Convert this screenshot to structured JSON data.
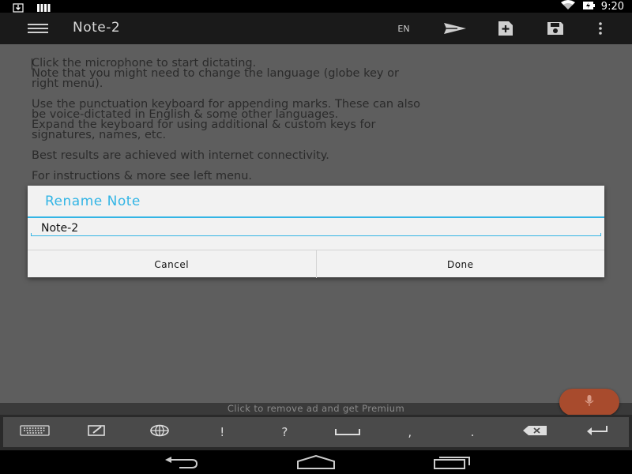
{
  "status_bar": {
    "time": "9:20",
    "icons": [
      "download-icon",
      "signal-bars-icon",
      "wifi-icon",
      "battery-charging-icon"
    ]
  },
  "action_bar": {
    "title": "Note-2",
    "language": "EN",
    "icons": [
      "menu-icon",
      "send-icon",
      "new-note-icon",
      "save-icon",
      "overflow-icon"
    ]
  },
  "note": {
    "paragraphs": [
      "Click the microphone to start dictating.\nNote that you might need to change the language (globe key or\nright menu).",
      "Use the punctuation keyboard for appending marks. These can also\nbe voice-dictated in English & some other languages.\nExpand the keyboard for using additional & custom keys for\nsignatures, names, etc.",
      "Best results are achieved with internet connectivity.",
      "For instructions & more see left menu."
    ]
  },
  "dialog": {
    "title": "Rename Note",
    "input_value": "Note-2",
    "cancel_label": "Cancel",
    "done_label": "Done"
  },
  "ad_banner": {
    "text": "Click to remove ad and get Premium"
  },
  "mic_button": {
    "icon": "microphone-icon",
    "color": "#a84b2d"
  },
  "keyboard_row": {
    "keys": [
      {
        "name": "keyboard-key",
        "icon": "keyboard-icon"
      },
      {
        "name": "edit-key",
        "icon": "edit-window-icon"
      },
      {
        "name": "globe-key",
        "icon": "globe-icon"
      },
      {
        "name": "exclamation-key",
        "label": "!"
      },
      {
        "name": "question-key",
        "label": "?"
      },
      {
        "name": "space-key",
        "icon": "space-icon"
      },
      {
        "name": "comma-key",
        "label": ","
      },
      {
        "name": "period-key",
        "label": "."
      },
      {
        "name": "backspace-key",
        "icon": "backspace-icon"
      },
      {
        "name": "enter-key",
        "icon": "enter-icon"
      }
    ]
  },
  "nav_bar": {
    "icons": [
      "back-icon",
      "home-icon",
      "recents-icon"
    ]
  },
  "colors": {
    "accent": "#33b5e5",
    "mic": "#a84b2d",
    "dimmed_background": "#5e5e5e"
  }
}
